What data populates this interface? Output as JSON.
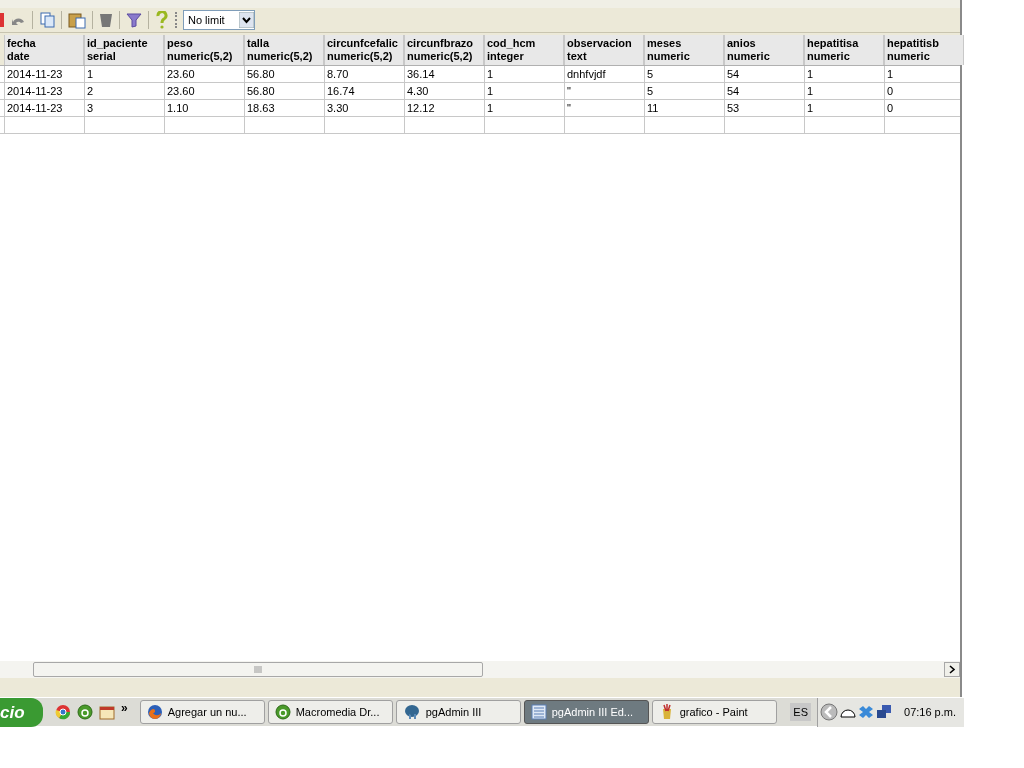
{
  "toolbar": {
    "limit": {
      "value": "No limit"
    }
  },
  "table": {
    "columns": [
      {
        "name": "fecha",
        "type": "date"
      },
      {
        "name": "id_paciente",
        "type": "serial"
      },
      {
        "name": "peso",
        "type": "numeric(5,2)"
      },
      {
        "name": "talla",
        "type": "numeric(5,2)"
      },
      {
        "name": "circunfcefalic",
        "type": "numeric(5,2)"
      },
      {
        "name": "circunfbrazo",
        "type": "numeric(5,2)"
      },
      {
        "name": "cod_hcm",
        "type": "integer"
      },
      {
        "name": "observacion",
        "type": "text"
      },
      {
        "name": "meses",
        "type": "numeric"
      },
      {
        "name": "anios",
        "type": "numeric"
      },
      {
        "name": "hepatitisa",
        "type": "numeric"
      },
      {
        "name": "hepatitisb",
        "type": "numeric"
      }
    ],
    "rows": [
      [
        "2014-11-23",
        "1",
        "23.60",
        "56.80",
        "8.70",
        "36.14",
        "1",
        "dnhfvjdf",
        "5",
        "54",
        "1",
        "1"
      ],
      [
        "2014-11-23",
        "2",
        "23.60",
        "56.80",
        "16.74",
        "4.30",
        "1",
        "\"",
        "5",
        "54",
        "1",
        "0"
      ],
      [
        "2014-11-23",
        "3",
        "1.10",
        "18.63",
        "3.30",
        "12.12",
        "1",
        "\"",
        "11",
        "53",
        "1",
        "0"
      ]
    ]
  },
  "taskbar": {
    "start": "cio",
    "more": "»",
    "tasks": [
      {
        "label": "Agregar un nu...",
        "kind": "firefox",
        "selected": false
      },
      {
        "label": "Macromedia Dr...",
        "kind": "dw",
        "selected": false
      },
      {
        "label": "pgAdmin III",
        "kind": "elephant",
        "selected": false
      },
      {
        "label": "pgAdmin III Ed...",
        "kind": "doc",
        "selected": true
      },
      {
        "label": "grafico - Paint",
        "kind": "paint",
        "selected": false
      }
    ],
    "language": "ES",
    "clock": "07:16 p.m."
  }
}
